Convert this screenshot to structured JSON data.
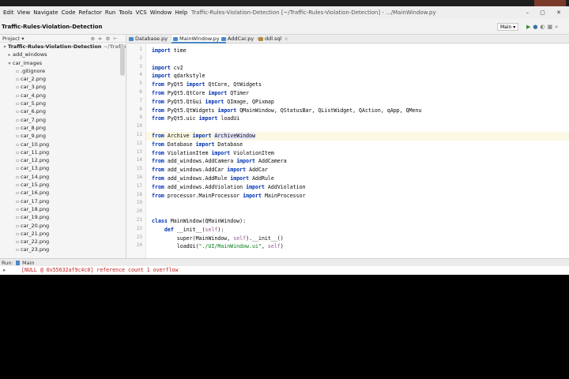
{
  "menubar": {
    "items": [
      "Edit",
      "View",
      "Navigate",
      "Code",
      "Refactor",
      "Run",
      "Tools",
      "VCS",
      "Window",
      "Help"
    ],
    "window_title": "Traffic-Rules-Violation-Detection [~/Traffic-Rules-Violation-Detection] - .../MainWindow.py"
  },
  "navbar": {
    "breadcrumb": "Traffic-Rules-Violation-Detection",
    "run_config": "Main ▾"
  },
  "project": {
    "header": "Project ▾",
    "root_name": "Traffic-Rules-Violation-Detection",
    "root_path": "~/Traffic-Rules-Violati...",
    "folders": [
      "add_windows",
      "car_images"
    ],
    "files": [
      ".gitignore",
      "car_2.png",
      "car_3.png",
      "car_4.png",
      "car_5.png",
      "car_6.png",
      "car_7.png",
      "car_8.png",
      "car_9.png",
      "car_10.png",
      "car_11.png",
      "car_12.png",
      "car_13.png",
      "car_14.png",
      "car_15.png",
      "car_16.png",
      "car_17.png",
      "car_18.png",
      "car_19.png",
      "car_20.png",
      "car_21.png",
      "car_22.png",
      "car_23.png"
    ]
  },
  "tabs": [
    {
      "label": "Database.py",
      "active": false,
      "type": "py"
    },
    {
      "label": "MainWindow.py",
      "active": true,
      "type": "py"
    },
    {
      "label": "AddCar.py",
      "active": false,
      "type": "py"
    },
    {
      "label": "ddl.sql",
      "active": false,
      "type": "sql"
    }
  ],
  "editor": {
    "first_line_number": 1,
    "current_line": 11,
    "lines": [
      "import time",
      "",
      "import cv2",
      "import qdarkstyle",
      "from PyQt5 import QtCore, QtWidgets",
      "from PyQt5.QtCore import QTimer",
      "from PyQt5.QtGui import QImage, QPixmap",
      "from PyQt5.QtWidgets import QMainWindow, QStatusBar, QListWidget, QAction, qApp, QMenu",
      "from PyQt5.uic import loadUi",
      "",
      "from Archive import ArchiveWindow",
      "from Database import Database",
      "from ViolationItem import ViolationItem",
      "from add_windows.AddCamera import AddCamera",
      "from add_windows.AddCar import AddCar",
      "from add_windows.AddRule import AddRule",
      "from add_windows.AddViolation import AddViolation",
      "from processor.MainProcessor import MainProcessor",
      "",
      "",
      "class MainWindow(QMainWindow):",
      "    def __init__(self):",
      "        super(MainWindow, self).__init__()",
      "        loadUi(\"./UI/MainWindow.ui\", self)"
    ]
  },
  "run_panel": {
    "label": "Run:",
    "tab": "Main",
    "output": "[NULL @ 0x55632af9c4c0] reference count 1 overflow"
  }
}
